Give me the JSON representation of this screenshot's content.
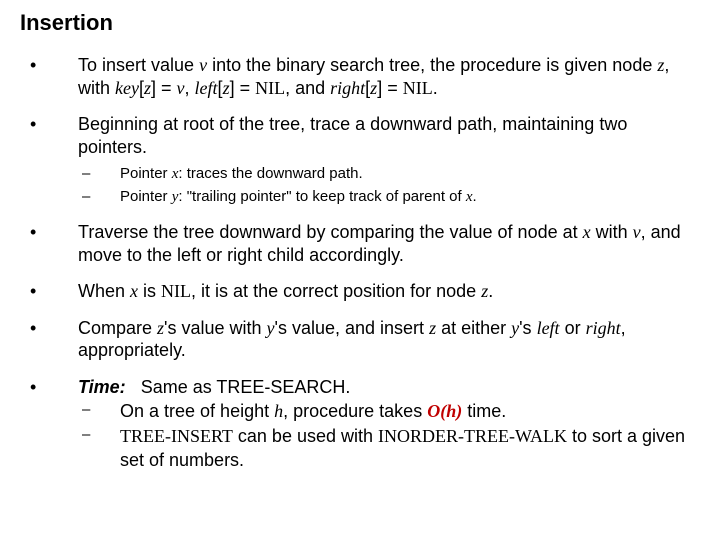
{
  "title": "Insertion",
  "p1_a": "To insert value ",
  "p1_v": "v",
  "p1_b": " into the binary search tree, the procedure is given node ",
  "p1_z": "z",
  "p1_c": ", with ",
  "p1_key": "key",
  "p1_d": "[",
  "p1_z2": "z",
  "p1_e": "] = ",
  "p1_v2": "v",
  "p1_f": ", ",
  "p1_left": "left",
  "p1_g": "[",
  "p1_z3": "z",
  "p1_h": "] = ",
  "p1_nil1": "NIL",
  "p1_i": ", and ",
  "p1_right": "right",
  "p1_j": "[",
  "p1_z4": "z",
  "p1_k": "] = ",
  "p1_nil2": "NIL",
  "p1_l": ".",
  "p2": "Beginning at root of the tree, trace a downward path, maintaining two pointers.",
  "p2s1_a": "Pointer ",
  "p2s1_x": "x",
  "p2s1_b": ": traces the downward path.",
  "p2s2_a": "Pointer ",
  "p2s2_y": "y",
  "p2s2_b": ": \"trailing pointer\" to keep track of parent of ",
  "p2s2_x": "x",
  "p2s2_c": ".",
  "p3_a": "Traverse the tree downward by comparing the value of node at ",
  "p3_x": "x",
  "p3_b": " with ",
  "p3_v": "v",
  "p3_c": ", and move to the left or right child accordingly.",
  "p4_a": "When ",
  "p4_x": "x",
  "p4_b": " is ",
  "p4_nil": "NIL",
  "p4_c": ", it is at the correct position for node ",
  "p4_z": "z",
  "p4_d": ".",
  "p5_a": "Compare ",
  "p5_z": "z",
  "p5_b": "'s value with ",
  "p5_y": "y",
  "p5_c": "'s value, and insert ",
  "p5_z2": "z",
  "p5_d": " at either ",
  "p5_y2": "y",
  "p5_e": "'s ",
  "p5_left": "left",
  "p5_f": " or ",
  "p5_right": "right",
  "p5_g": ", appropriately.",
  "p6_time": "Time:",
  "p6_a": "   Same as TREE-SEARCH.",
  "p6s1_a": "On a tree of height ",
  "p6s1_h": "h",
  "p6s1_b": ", procedure takes ",
  "p6s1_oh": "O(h)",
  "p6s1_c": " time.",
  "p6s2_a": "TREE-INSERT",
  "p6s2_b": " can be used with ",
  "p6s2_c": "INORDER-TREE-WALK",
  "p6s2_d": " to sort a given set of numbers.",
  "bullet": "•",
  "dash": "–"
}
